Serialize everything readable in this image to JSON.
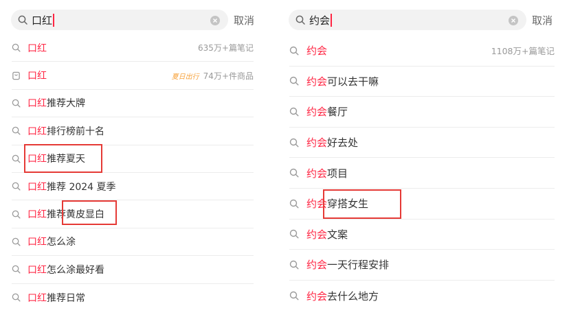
{
  "left": {
    "query_prefix": "口红",
    "cancel_label": "取消",
    "rows": [
      {
        "icon": "search-icon",
        "highlight": "口红",
        "rest": "",
        "meta": "635万+篇笔记",
        "badge": ""
      },
      {
        "icon": "product-bag-icon",
        "highlight": "口红",
        "rest": "",
        "meta": "74万+件商品",
        "badge": "夏日出行"
      },
      {
        "icon": "search-icon",
        "highlight": "口红",
        "rest": "推荐大牌",
        "meta": "",
        "badge": ""
      },
      {
        "icon": "search-icon",
        "highlight": "口红",
        "rest": "排行榜前十名",
        "meta": "",
        "badge": ""
      },
      {
        "icon": "search-icon",
        "highlight": "口红",
        "rest": "推荐夏天",
        "meta": "",
        "badge": ""
      },
      {
        "icon": "search-icon",
        "highlight": "口红",
        "rest": "推荐 2024 夏季",
        "meta": "",
        "badge": ""
      },
      {
        "icon": "search-icon",
        "highlight": "口红",
        "rest": "推荐黄皮显白",
        "meta": "",
        "badge": ""
      },
      {
        "icon": "search-icon",
        "highlight": "口红",
        "rest": "怎么涂",
        "meta": "",
        "badge": ""
      },
      {
        "icon": "search-icon",
        "highlight": "口红",
        "rest": "怎么涂最好看",
        "meta": "",
        "badge": ""
      },
      {
        "icon": "search-icon",
        "highlight": "口红",
        "rest": "推荐日常",
        "meta": "",
        "badge": ""
      }
    ]
  },
  "right": {
    "query_prefix": "约会",
    "cancel_label": "取消",
    "rows": [
      {
        "icon": "search-icon",
        "highlight": "约会",
        "rest": "",
        "meta": "1108万+篇笔记"
      },
      {
        "icon": "search-icon",
        "highlight": "约会",
        "rest": "可以去干嘛",
        "meta": ""
      },
      {
        "icon": "search-icon",
        "highlight": "约会",
        "rest": "餐厅",
        "meta": ""
      },
      {
        "icon": "search-icon",
        "highlight": "约会",
        "rest": "好去处",
        "meta": ""
      },
      {
        "icon": "search-icon",
        "highlight": "约会",
        "rest": "项目",
        "meta": ""
      },
      {
        "icon": "search-icon",
        "highlight": "约会",
        "rest": "穿搭女生",
        "meta": ""
      },
      {
        "icon": "search-icon",
        "highlight": "约会",
        "rest": "文案",
        "meta": ""
      },
      {
        "icon": "search-icon",
        "highlight": "约会",
        "rest": "一天行程安排",
        "meta": ""
      },
      {
        "icon": "search-icon",
        "highlight": "约会",
        "rest": "去什么地方",
        "meta": ""
      }
    ]
  },
  "colors": {
    "accent": "#ff2442",
    "annotation": "#e53935",
    "badge": "#f7a23b"
  }
}
